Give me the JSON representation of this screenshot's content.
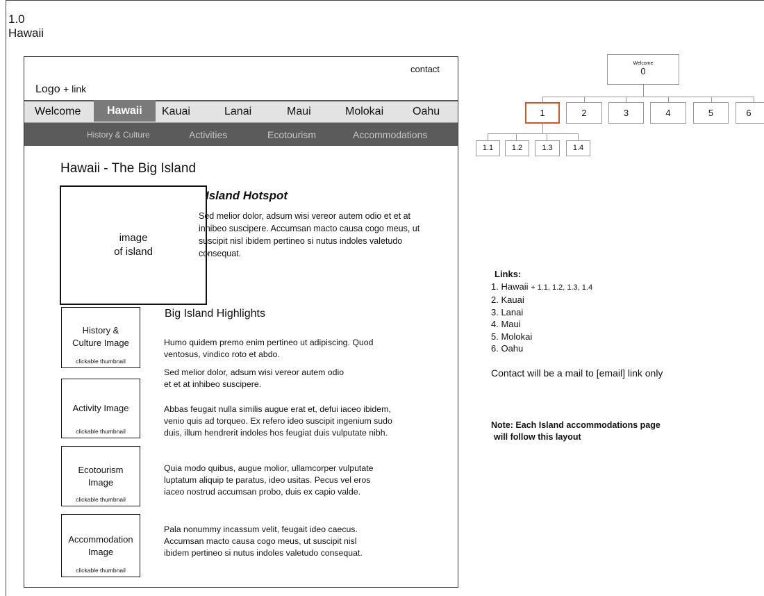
{
  "page_id": {
    "number": "1.0",
    "name": "Hawaii"
  },
  "wireframe": {
    "contact": "contact",
    "logo": {
      "main": "Logo",
      "suffix": "+ link"
    },
    "main_nav": [
      "Welcome",
      "Hawaii",
      "Kauai",
      "Lanai",
      "Maui",
      "Molokai",
      "Oahu"
    ],
    "sub_nav": [
      "History & Culture",
      "Activities",
      "Ecotourism",
      "Accommodations"
    ],
    "page_title": "Hawaii - The Big Island",
    "island_image": {
      "line1": "image",
      "line2": "of island"
    },
    "hotspot": {
      "heading": "Island Hotspot",
      "text": "Sed melior dolor, adsum wisi vereor autem odio et et at inhibeo suscipere. Accumsan macto causa cogo meus, ut suscipit nisl ibidem pertineo si nutus indoles valetudo consequat."
    },
    "highlights_heading": "Big Island Highlights",
    "thumbnails": [
      {
        "line1": "History &",
        "line2": "Culture Image",
        "caption": "clickable thumbnail"
      },
      {
        "line1": "Activity Image",
        "line2": "",
        "caption": "clickable thumbnail"
      },
      {
        "line1": "Ecotourism",
        "line2": "Image",
        "caption": "clickable thumbnail"
      },
      {
        "line1": "Accommodation",
        "line2": "Image",
        "caption": "clickable thumbnail"
      }
    ],
    "paragraphs": [
      "Humo quidem premo enim pertineo ut adipiscing. Quod ventosus, vindico roto et abdo.",
      "Sed melior dolor, adsum wisi vereor autem odio et et at inhibeo suscipere.",
      "Abbas feugait nulla similis augue erat et, defui iaceo ibidem, venio quis ad torqueo. Ex refero ideo suscipit ingenium sudo duis, illum hendrerit indoles hos feugiat duis vulputate nibh.",
      "Quia modo quibus, augue molior, ullamcorper vulputate luptatum aliquip te paratus, ideo usitas. Pecus vel eros iaceo nostrud accumsan probo, duis ex capio valde.",
      "Pala nonummy incassum velit, feugait ideo caecus. Accumsan macto causa cogo meus, ut suscipit nisl ibidem pertineo si nutus indoles valetudo consequat."
    ]
  },
  "sitemap": {
    "root": {
      "label": "Welcome",
      "number": "0"
    },
    "level1": [
      "1",
      "2",
      "3",
      "4",
      "5",
      "6"
    ],
    "level2": [
      "1.1",
      "1.2",
      "1.3",
      "1.4"
    ],
    "highlight_color": "#d9531e"
  },
  "links": {
    "heading": "Links:",
    "items": [
      "1. Hawaii",
      "2. Kauai",
      "3. Lanai",
      "4. Maui",
      "5. Molokai",
      "6. Oahu"
    ],
    "hawaii_suffix": "+ 1.1, 1.2, 1.3, 1.4"
  },
  "contact_note": "Contact will be a mail to [email] link only",
  "note": {
    "line1": "Note: Each Island accommodations page",
    "line2": "will follow this layout"
  }
}
